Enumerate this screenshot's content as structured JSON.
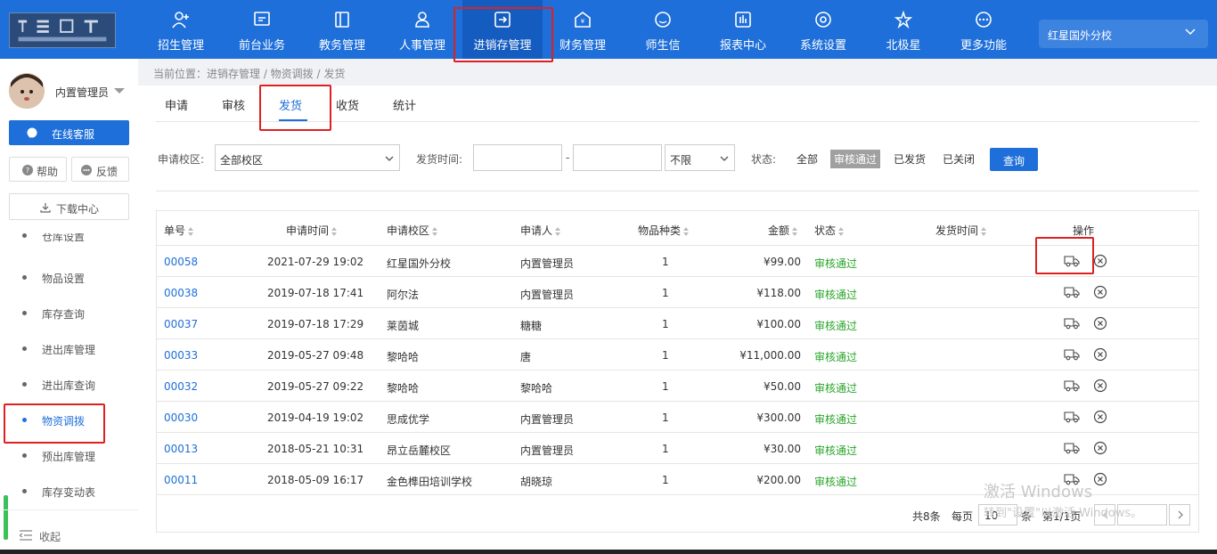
{
  "nav": {
    "items": [
      {
        "label": "招生管理",
        "icon": "user-plus-icon"
      },
      {
        "label": "前台业务",
        "icon": "monitor-icon"
      },
      {
        "label": "教务管理",
        "icon": "book-icon"
      },
      {
        "label": "人事管理",
        "icon": "person-icon"
      },
      {
        "label": "进销存管理",
        "icon": "export-icon"
      },
      {
        "label": "财务管理",
        "icon": "finance-icon"
      },
      {
        "label": "师生信",
        "icon": "chat-icon"
      },
      {
        "label": "报表中心",
        "icon": "report-icon"
      },
      {
        "label": "系统设置",
        "icon": "settings-icon"
      },
      {
        "label": "北极星",
        "icon": "star-icon"
      },
      {
        "label": "更多功能",
        "icon": "more-icon"
      }
    ],
    "active_index": 4,
    "campus": "红星国外分校",
    "accent": "#1e6fd9"
  },
  "sidebar": {
    "username": "内置管理员",
    "online_service": "在线客服",
    "help": "帮助",
    "feedback": "反馈",
    "download": "下载中心",
    "partial_item": "仓库设置",
    "menu": [
      "物品设置",
      "库存查询",
      "进出库管理",
      "进出库查询",
      "物资调拨",
      "预出库管理",
      "库存变动表"
    ],
    "active_menu": "物资调拨",
    "collapse": "收起"
  },
  "breadcrumb": "当前位置：进销存管理 / 物资调拨 / 发货",
  "tabs": [
    "申请",
    "审核",
    "发货",
    "收货",
    "统计"
  ],
  "active_tab": "发货",
  "filters": {
    "campus_label": "申请校区:",
    "campus_value": "全部校区",
    "time_label": "发货时间:",
    "time_sep": "-",
    "time_range": "不限",
    "status_label": "状态:",
    "status_options": [
      "全部",
      "审核通过",
      "已发货",
      "已关闭"
    ],
    "status_active": "审核通过",
    "query": "查询"
  },
  "table": {
    "headers": [
      "单号",
      "申请时间",
      "申请校区",
      "申请人",
      "物品种类",
      "金额",
      "状态",
      "发货时间",
      "操作"
    ],
    "rows": [
      {
        "id": "00058",
        "time": "2021-07-29 19:02",
        "campus": "红星国外分校",
        "applicant": "内置管理员",
        "kinds": "1",
        "amount": "¥99.00",
        "status": "审核通过",
        "ship_time": ""
      },
      {
        "id": "00038",
        "time": "2019-07-18 17:41",
        "campus": "阿尔法",
        "applicant": "内置管理员",
        "kinds": "1",
        "amount": "¥118.00",
        "status": "审核通过",
        "ship_time": ""
      },
      {
        "id": "00037",
        "time": "2019-07-18 17:29",
        "campus": "莱茵城",
        "applicant": "糖糖",
        "kinds": "1",
        "amount": "¥100.00",
        "status": "审核通过",
        "ship_time": ""
      },
      {
        "id": "00033",
        "time": "2019-05-27 09:48",
        "campus": "黎哈哈",
        "applicant": "唐",
        "kinds": "1",
        "amount": "¥11,000.00",
        "status": "审核通过",
        "ship_time": ""
      },
      {
        "id": "00032",
        "time": "2019-05-27 09:22",
        "campus": "黎哈哈",
        "applicant": "黎哈哈",
        "kinds": "1",
        "amount": "¥50.00",
        "status": "审核通过",
        "ship_time": ""
      },
      {
        "id": "00030",
        "time": "2019-04-19 19:02",
        "campus": "思成优学",
        "applicant": "内置管理员",
        "kinds": "1",
        "amount": "¥300.00",
        "status": "审核通过",
        "ship_time": ""
      },
      {
        "id": "00013",
        "time": "2018-05-21 10:31",
        "campus": "昂立岳麓校区",
        "applicant": "内置管理员",
        "kinds": "1",
        "amount": "¥30.00",
        "status": "审核通过",
        "ship_time": ""
      },
      {
        "id": "00011",
        "time": "2018-05-09 16:17",
        "campus": "金色榫田培训学校",
        "applicant": "胡晓琼",
        "kinds": "1",
        "amount": "¥200.00",
        "status": "审核通过",
        "ship_time": ""
      }
    ],
    "actions": [
      "truck-icon",
      "close-circle-icon"
    ]
  },
  "pager": {
    "total": "共8条",
    "per_page_label": "每页",
    "per_page": "10",
    "per_page_unit": "条",
    "page_info": "第1/1页",
    "jump_placeholder": ""
  },
  "watermark": {
    "line1": "激活 Windows",
    "line2": "转到\"设置\"以激活 Windows。"
  }
}
